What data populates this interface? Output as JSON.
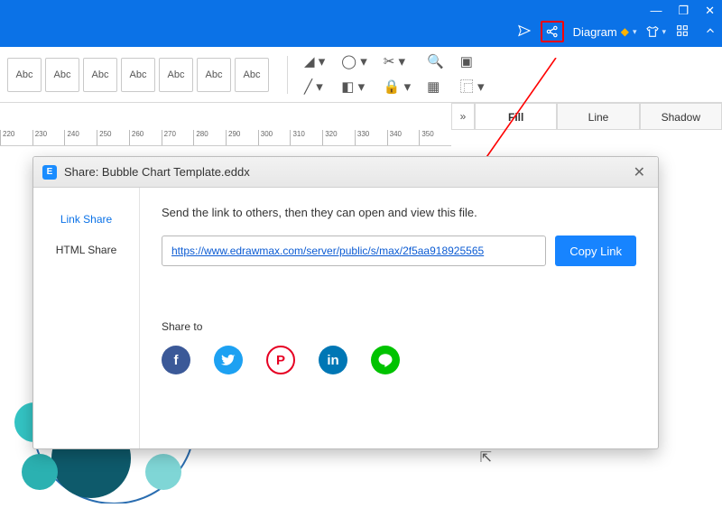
{
  "window": {
    "controls": {
      "minimize": "—",
      "maximize": "❐",
      "close": "✕"
    }
  },
  "header": {
    "diagram_label": "Diagram"
  },
  "toolbar": {
    "styles": [
      "Abc",
      "Abc",
      "Abc",
      "Abc",
      "Abc",
      "Abc",
      "Abc"
    ]
  },
  "side_panel": {
    "tabs": {
      "fill": "Fill",
      "line": "Line",
      "shadow": "Shadow"
    }
  },
  "ruler_ticks": [
    "220",
    "230",
    "240",
    "250",
    "260",
    "270",
    "280",
    "290",
    "300",
    "310",
    "320",
    "330",
    "340",
    "350"
  ],
  "dialog": {
    "title": "Share: Bubble Chart Template.eddx",
    "nav": {
      "link_share": "Link Share",
      "html_share": "HTML Share"
    },
    "desc": "Send the link to others, then they can open and view this file.",
    "url": "https://www.edrawmax.com/server/public/s/max/2f5aa918925565",
    "copy": "Copy Link",
    "share_to": "Share to"
  }
}
